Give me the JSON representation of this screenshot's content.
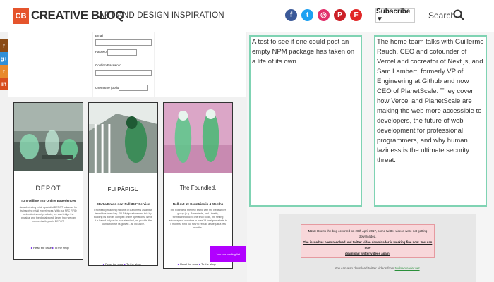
{
  "header": {
    "logo_mark": "CB",
    "logo_word": "CREATIVE BLOQ",
    "tagline": "ART AND DESIGN INSPIRATION",
    "subscribe_label": "Subscribe ▼",
    "search_label": "Search",
    "social": [
      {
        "name": "facebook-icon",
        "glyph": "f",
        "color": "#3b5998"
      },
      {
        "name": "twitter-icon",
        "glyph": "t",
        "color": "#1da1f2"
      },
      {
        "name": "instagram-icon",
        "glyph": "◎",
        "color": "#e1306c"
      },
      {
        "name": "pinterest-icon",
        "glyph": "P",
        "color": "#cb2027"
      },
      {
        "name": "flipboard-icon",
        "glyph": "F",
        "color": "#e12828"
      }
    ]
  },
  "share_bar": [
    {
      "name": "facebook-share-icon",
      "glyph": "f",
      "color": "#8a4b15"
    },
    {
      "name": "googleplus-share-icon",
      "glyph": "g+",
      "color": "#2f8fd7"
    },
    {
      "name": "twitter-share-icon",
      "glyph": "t",
      "color": "#e8892b"
    },
    {
      "name": "linkedin-share-icon",
      "glyph": "in",
      "color": "#d84e1e"
    }
  ],
  "form": {
    "email_label": "Email",
    "password_label": "Password",
    "confirm_label": "Confirm Password",
    "username_label": "Username (optional)"
  },
  "cards": [
    {
      "brand": "DEPOT",
      "title": "Turn Offline Into Online Experiences",
      "desc": "Award-winning retail specialist DEPOT is known for its inspiring retail experiences. With our NFC RFID embedded smart products, we can bridge the physical and the digital world. Learn how we can connect with you in DEPOT.",
      "link1": "Read the case",
      "link2": "To the shop"
    },
    {
      "brand": "FLI PÄPIGU",
      "title": "Start a Brand-new Full 360° Service",
      "desc": "Effortlessly reaching millions of customers as a new brand has been key. FLI Päpigu addressed this by building us with its complex online operations. While it is based fully on its own standard, we provide the foundation for its growth - all inclusive.",
      "link1": "Read the case",
      "link2": "To the shop"
    },
    {
      "brand": "The Foundled.",
      "title": "Roll out 19 Countries in 4 Months",
      "desc": "The Foundled, the new brand with the Bedeweiler group (e.g. Rosenfelds, and Limetti), formed/introduced one shop code, the selling advantage of our store in over 19 foreign markets in 4 months. Find out how to rebuild a site just a few months.",
      "link1": "Read the case",
      "link2": "To the shop"
    }
  ],
  "purple_button_label": "Join our mailing list",
  "text_left": "A test to see if one could post an empty NPM package has taken on a life of its own",
  "text_right": "The home team talks with Guillermo Rauch, CEO and cofounder of Vercel and cocreator of Next.js, and Sam Lambert, formerly VP of Engineering at Github and now CEO of PlanetScale. They cover how Vercel and PlanetScale are making the web more accessible to developers, the future of web development for professional programmers, and why human laziness is the ultimate security threat.",
  "notice": {
    "line1_bold": "Note:",
    "line1": "Due to the bug occurred on 28th April 2017, some twitter videos were not getting downloaded.",
    "line2": "The issue has been resolved and twitter video downloader is working fine now. You can now",
    "line3": "download twitter videos again.",
    "extra_text": "You can also download twitter videos from",
    "extra_link": "twdownloader.net"
  }
}
